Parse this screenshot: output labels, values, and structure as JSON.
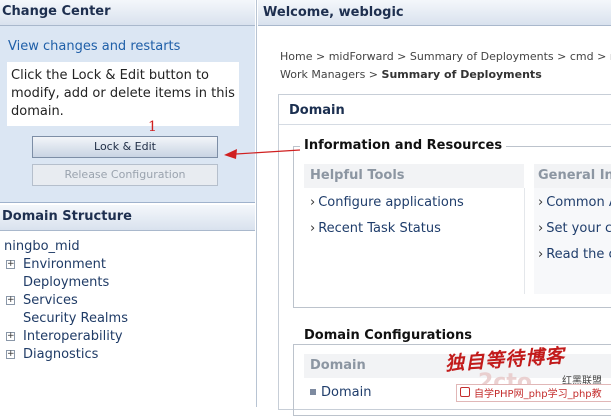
{
  "change_center": {
    "title": "Change Center",
    "link": "View changes and restarts",
    "message": "Click the Lock & Edit button to modify, add or delete items in this domain.",
    "lock_edit_button": "Lock & Edit",
    "release_button": "Release Configuration"
  },
  "annotation": {
    "number": "1",
    "color": "#d02020"
  },
  "domain_structure": {
    "title": "Domain Structure",
    "root": "ningbo_mid",
    "items": [
      {
        "label": "Environment",
        "expandable": true
      },
      {
        "label": "Deployments",
        "expandable": false
      },
      {
        "label": "Services",
        "expandable": true
      },
      {
        "label": "Security Realms",
        "expandable": false
      },
      {
        "label": "Interoperability",
        "expandable": true
      },
      {
        "label": "Diagnostics",
        "expandable": true
      }
    ]
  },
  "header": {
    "welcome": "Welcome, weblogic"
  },
  "breadcrumb": {
    "line1": "Home > midForward > Summary of Deployments > cmd > mi",
    "line2_prefix": "Work Managers > ",
    "line2_current": "Summary of Deployments"
  },
  "domain_panel": {
    "title": "Domain",
    "info_legend": "Information and Resources",
    "helpful_tools": {
      "title": "Helpful Tools",
      "links": [
        "Configure applications",
        "Recent Task Status"
      ]
    },
    "general_info": {
      "title": "General Inf",
      "links": [
        "Common A",
        "Set your c",
        "Read the c"
      ]
    },
    "configurations": {
      "legend": "Domain Configurations",
      "column_title": "Domain",
      "row": "Domain"
    }
  },
  "watermark": {
    "script_text": "独自等待博客",
    "logo": "2cto",
    "side_text": "红黑联盟",
    "bar_text": "自学PHP网_php学习_php教"
  },
  "colors": {
    "panel_bg": "#dbe6f3",
    "link": "#1f5fa8",
    "arrow": "#d02020"
  },
  "icons": {
    "tree_expander": "plus-box-icon",
    "link_bullet": "chevron-right-icon",
    "arrow": "arrow-left-icon"
  }
}
